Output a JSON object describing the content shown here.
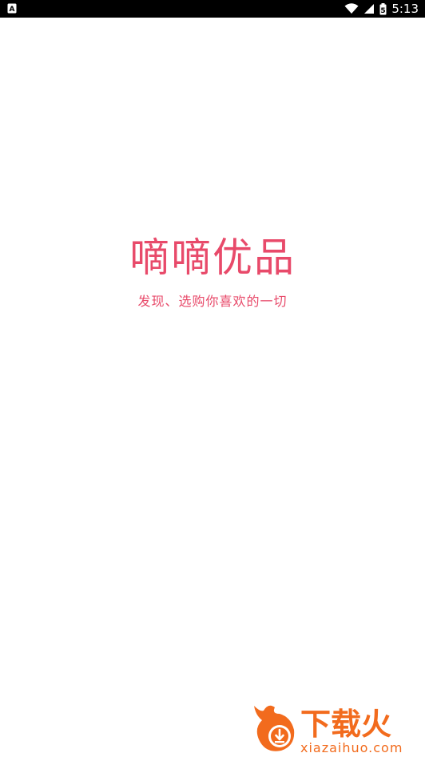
{
  "status_bar": {
    "time": "5:13",
    "battery_level": "5"
  },
  "splash": {
    "app_name": "嘀嘀优品",
    "slogan": "发现、选购你喜欢的一切"
  },
  "watermark": {
    "brand_text": "下载火",
    "site_text": "xiazaihuo.com"
  },
  "colors": {
    "accent": "#e84a6a",
    "status_bar": "#000000",
    "background": "#ffffff",
    "watermark_orange": "#f26b1d"
  }
}
